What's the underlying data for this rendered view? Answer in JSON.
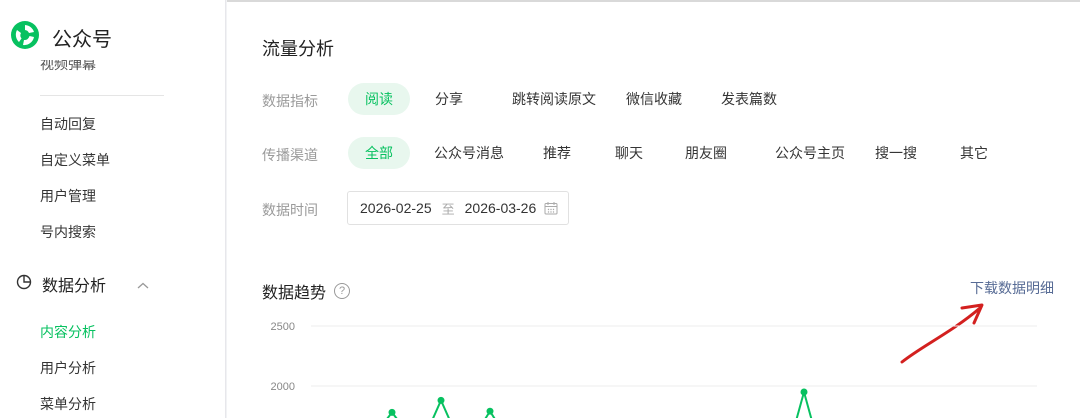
{
  "sidebar": {
    "brand": "公众号",
    "cut_item": "视频弹幕",
    "links": [
      "自动回复",
      "自定义菜单",
      "用户管理",
      "号内搜索"
    ],
    "section": "数据分析",
    "sub_links": [
      "内容分析",
      "用户分析",
      "菜单分析"
    ]
  },
  "main": {
    "title": "流量分析",
    "metric": {
      "label": "数据指标",
      "options": [
        "阅读",
        "分享",
        "跳转阅读原文",
        "微信收藏",
        "发表篇数"
      ]
    },
    "channel": {
      "label": "传播渠道",
      "options": [
        "全部",
        "公众号消息",
        "推荐",
        "聊天",
        "朋友圈",
        "公众号主页",
        "搜一搜",
        "其它"
      ]
    },
    "time": {
      "label": "数据时间",
      "start": "2026-02-25",
      "sep": "至",
      "end": "2026-03-26"
    },
    "trend_title": "数据趋势",
    "help": "?",
    "download": "下载数据明细"
  },
  "colors": {
    "accent": "#07c160",
    "link": "#576b95",
    "annotation": "#d3201f"
  },
  "chart_data": {
    "type": "line",
    "y_ticks": [
      "2500",
      "2000"
    ],
    "ylim_visible": [
      1750,
      2500
    ],
    "points": [
      {
        "x": 1,
        "y": 1780
      },
      {
        "x": 2,
        "y": 1880
      },
      {
        "x": 3,
        "y": 1790
      },
      {
        "x": 4,
        "y": 1950
      }
    ]
  }
}
